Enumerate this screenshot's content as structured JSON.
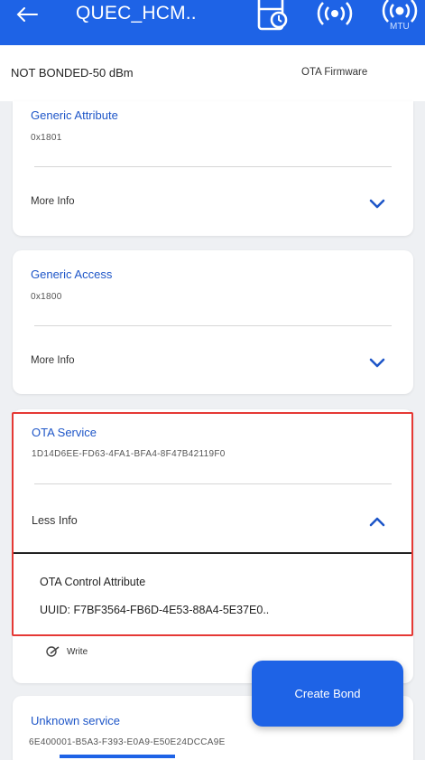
{
  "header": {
    "back_icon": "arrow-left-icon",
    "title": "QUEC_HCM..",
    "icons": [
      "calendar-clock-icon",
      "broadcast-icon",
      "mtu-broadcast-icon"
    ],
    "mtu_label": "MTU",
    "background": "#1e63e6"
  },
  "status": {
    "bond_text": "NOT BONDED-50 dBm",
    "ota_text": "OTA Firmware"
  },
  "services": [
    {
      "name": "Generic Attribute",
      "uuid": "0x1801",
      "toggle_label": "More Info",
      "expanded": false
    },
    {
      "name": "Generic Access",
      "uuid": "0x1800",
      "toggle_label": "More Info",
      "expanded": false
    },
    {
      "name": "OTA Service",
      "uuid": "1D14D6EE-FD63-4FA1-BFA4-8F47B42119F0",
      "toggle_label": "Less Info",
      "expanded": true,
      "characteristic": {
        "name": "OTA Control Attribute",
        "uuid_text": "UUID: F7BF3564-FB6D-4E53-88A4-5E37E0..",
        "property": "Write"
      }
    },
    {
      "name": "Unknown service",
      "uuid": "6E400001-B5A3-F393-E0A9-E50E24DCCA9E"
    }
  ],
  "fab": {
    "label": "Create Bond"
  },
  "colors": {
    "accent": "#1e63e6",
    "highlight": "#e53935",
    "link": "#1e56c8"
  }
}
